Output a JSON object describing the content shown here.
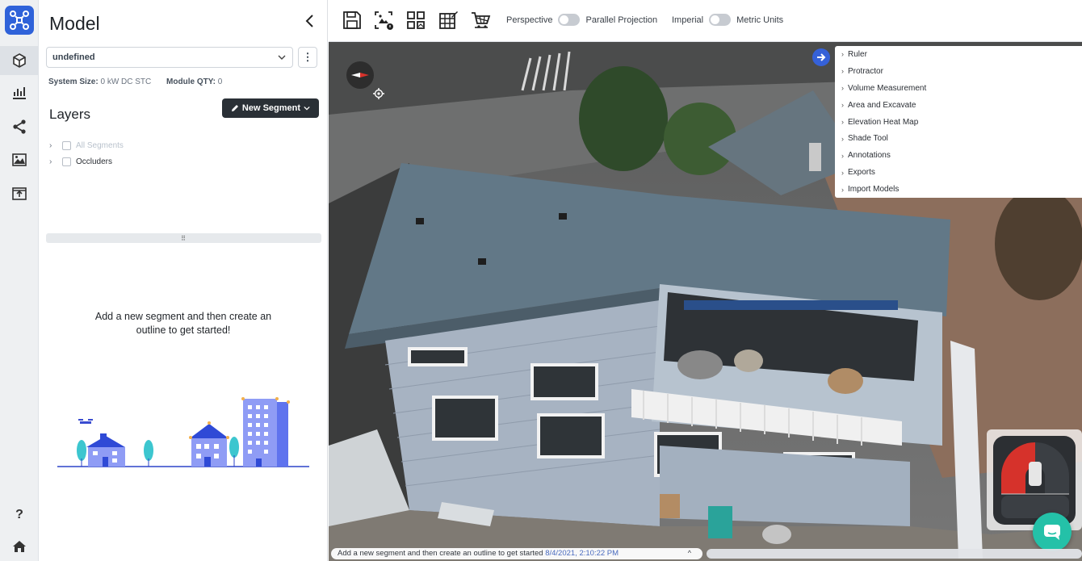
{
  "rail": {
    "items": [
      {
        "name": "model",
        "icon": "cube-icon"
      },
      {
        "name": "reports",
        "icon": "bar-chart-icon"
      },
      {
        "name": "share",
        "icon": "share-icon"
      },
      {
        "name": "images",
        "icon": "image-icon"
      },
      {
        "name": "upload",
        "icon": "upload-icon"
      }
    ],
    "help_label": "?",
    "home_icon": "home-icon"
  },
  "panel": {
    "title": "Model",
    "select_value": "undefined",
    "kebab": "⋮",
    "system_size_label": "System Size:",
    "system_size_value": "0 kW DC STC",
    "module_qty_label": "Module QTY:",
    "module_qty_value": "0",
    "layers_title": "Layers",
    "new_segment_label": "New Segment",
    "tree": [
      {
        "label": "All Segments",
        "muted": true
      },
      {
        "label": "Occluders",
        "muted": false
      }
    ],
    "divider_grip": "⠿",
    "empty_message": "Add a new segment and then create an outline to get started!"
  },
  "toolbar": {
    "buttons": [
      "save-icon",
      "image-settings-icon",
      "grid-layout-icon",
      "edit-grid-icon",
      "cart-icon"
    ],
    "perspective_label": "Perspective",
    "parallel_label": "Parallel Projection",
    "imperial_label": "Imperial",
    "metric_label": "Metric Units"
  },
  "tools": {
    "items": [
      "Ruler",
      "Protractor",
      "Volume Measurement",
      "Area and Excavate",
      "Elevation Heat Map",
      "Shade Tool",
      "Annotations",
      "Exports",
      "Import Models"
    ]
  },
  "status": {
    "message": "Add a new segment and then create an outline to get started",
    "timestamp": "8/4/2021, 2:10:22 PM",
    "caret": "^"
  },
  "colors": {
    "brand": "#2f62d9",
    "dark_button": "#2a3036",
    "chat": "#24c1a8"
  }
}
